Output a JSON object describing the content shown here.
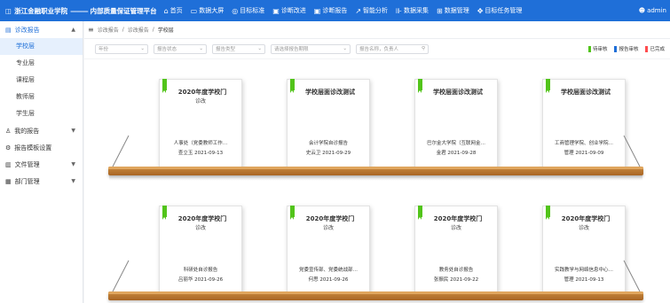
{
  "header": {
    "brand_name": "浙江金融职业学院",
    "brand_sep": "———",
    "platform": "内部质量保证管理平台",
    "nav": [
      {
        "icon": "⌂",
        "label": "首页"
      },
      {
        "icon": "▭",
        "label": "数据大屏"
      },
      {
        "icon": "◎",
        "label": "目标标准"
      },
      {
        "icon": "▣",
        "label": "诊断改进"
      },
      {
        "icon": "▣",
        "label": "诊断报告"
      },
      {
        "icon": "↗",
        "label": "智能分析"
      },
      {
        "icon": "⊪",
        "label": "数据采集"
      },
      {
        "icon": "⊞",
        "label": "数据管理"
      },
      {
        "icon": "✥",
        "label": "目标任务管理"
      }
    ],
    "user": "admin"
  },
  "sidebar": {
    "diag_label": "诊改报告",
    "sub": [
      "学校层",
      "专业层",
      "课程层",
      "教师层",
      "学生层"
    ],
    "groups": [
      "我的报告",
      "报告模板设置",
      "文件管理",
      "部门管理"
    ]
  },
  "breadcrumb": [
    "诊改报告",
    "诊改报告",
    "学校层"
  ],
  "filters": [
    "年份",
    "报告状态",
    "报告类型",
    "请选择报告期限",
    "报告名称，负责人"
  ],
  "legend": [
    {
      "label": "待审核",
      "color": "#52c41a"
    },
    {
      "label": "报告审核",
      "color": "#1f6fd8"
    },
    {
      "label": "已完成",
      "color": "#ff4d4f"
    }
  ],
  "books": [
    {
      "title": "2020年度学校门",
      "stat": "诊改",
      "name": "人事处（党委教师工作…",
      "meta": "查立玉 2021-09-13"
    },
    {
      "title": "学校层面诊改测试",
      "stat": "",
      "name": "会计学院自诊报告",
      "meta": "史云卫 2021-09-29"
    },
    {
      "title": "学校层面诊改测试",
      "stat": "",
      "name": "巴尔金大学院（互联网金…",
      "meta": "金君 2021-09-28"
    },
    {
      "title": "学校层面诊改测试",
      "stat": "",
      "name": "工商管理学院、创业学院…",
      "meta": "管理 2021-09-09"
    },
    {
      "title": "2020年度学校门",
      "stat": "诊改",
      "name": "科研处自诊报告",
      "meta": "吕丽华 2021-09-26"
    },
    {
      "title": "2020年度学校门",
      "stat": "诊改",
      "name": "党委宣传部、党委统战部…",
      "meta": "何思 2021-09-26"
    },
    {
      "title": "2020年度学校门",
      "stat": "诊改",
      "name": "教务处自诊报告",
      "meta": "张振民 2021-09-22"
    },
    {
      "title": "2020年度学校门",
      "stat": "诊改",
      "name": "实践教学与网络信息中心…",
      "meta": "管理 2021-09-13"
    }
  ]
}
